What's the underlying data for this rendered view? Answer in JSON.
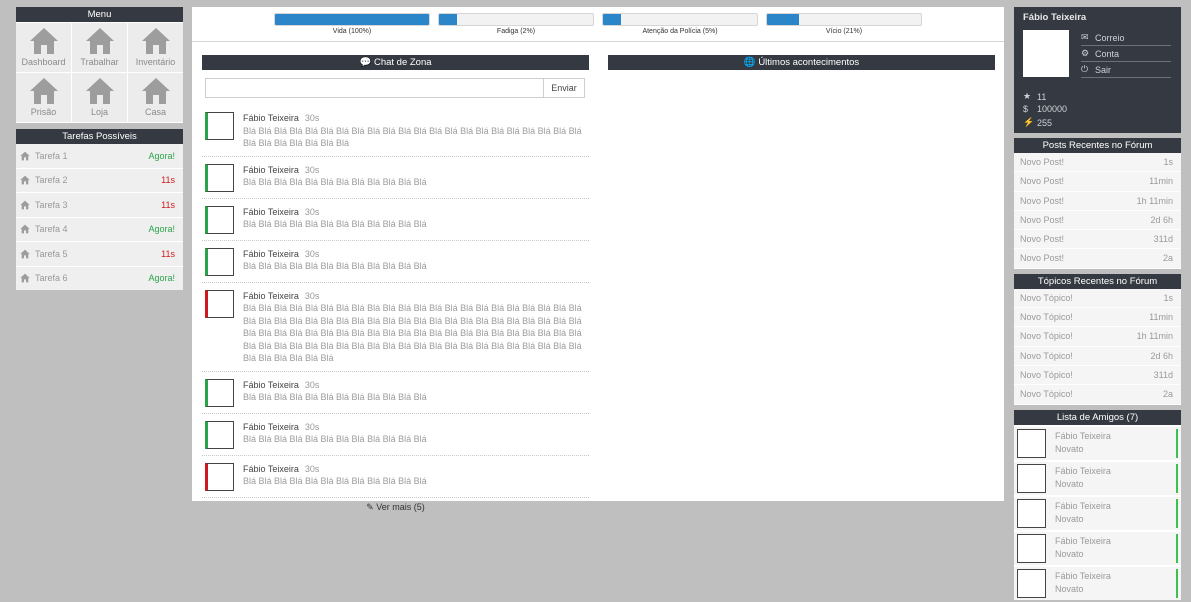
{
  "menu": {
    "title": "Menu",
    "items": [
      {
        "label": "Dashboard",
        "icon": "house-icon"
      },
      {
        "label": "Trabalhar",
        "icon": "house-icon"
      },
      {
        "label": "Inventário",
        "icon": "house-icon"
      },
      {
        "label": "Prisão",
        "icon": "house-icon"
      },
      {
        "label": "Loja",
        "icon": "house-icon"
      },
      {
        "label": "Casa",
        "icon": "house-icon"
      }
    ]
  },
  "tasks": {
    "title": "Tarefas Possíveis",
    "items": [
      {
        "name": "Tarefa 1",
        "time": "Agora!",
        "status": "green"
      },
      {
        "name": "Tarefa 2",
        "time": "11s",
        "status": "red"
      },
      {
        "name": "Tarefa 3",
        "time": "11s",
        "status": "red"
      },
      {
        "name": "Tarefa 4",
        "time": "Agora!",
        "status": "green"
      },
      {
        "name": "Tarefa 5",
        "time": "11s",
        "status": "red"
      },
      {
        "name": "Tarefa 6",
        "time": "Agora!",
        "status": "green"
      }
    ]
  },
  "bars": [
    {
      "label": "Vida (100%)",
      "value": 100
    },
    {
      "label": "Fadiga (2%)",
      "value": 2
    },
    {
      "label": "Atenção da Polícia (5%)",
      "value": 5
    },
    {
      "label": "Vício (21%)",
      "value": 21
    }
  ],
  "chat": {
    "title": "Chat de Zona",
    "input_placeholder": "",
    "send_label": "Enviar",
    "messages": [
      {
        "author": "Fábio Teixeira",
        "ago": "30s",
        "text": "Blá Blá Blá Blá Blá Blá Blá Blá Blá Blá Blá Blá Blá Blá Blá Blá Blá Blá Blá Blá Blá Blá Blá Blá Blá Blá Blá Blá Blá",
        "accent": "#2ba34a"
      },
      {
        "author": "Fábio Teixeira",
        "ago": "30s",
        "text": "Blá Blá Blá Blá Blá Blá Blá Blá Blá Blá Blá Blá",
        "accent": "#2ba34a"
      },
      {
        "author": "Fábio Teixeira",
        "ago": "30s",
        "text": "Blá Blá Blá Blá Blá Blá Blá Blá Blá Blá Blá Blá",
        "accent": "#2ba34a"
      },
      {
        "author": "Fábio Teixeira",
        "ago": "30s",
        "text": "Blá Blá Blá Blá Blá Blá Blá Blá Blá Blá Blá Blá",
        "accent": "#2ba34a"
      },
      {
        "author": "Fábio Teixeira",
        "ago": "30s",
        "text": "Blá Blá Blá Blá Blá Blá Blá Blá Blá Blá Blá Blá Blá Blá Blá Blá Blá Blá Blá Blá Blá Blá Blá Blá Blá Blá Blá Blá Blá Blá Blá Blá Blá Blá Blá Blá Blá Blá Blá Blá Blá Blá Blá Blá Blá Blá Blá Blá Blá Blá Blá Blá Blá Blá Blá Blá Blá Blá Blá Blá Blá Blá Blá Blá Blá Blá Blá Blá Blá Blá Blá Blá Blá Blá Blá Blá Blá Blá Blá Blá Blá Blá Blá Blá Blá Blá Blá Blá Blá Blá Blá Blá Blá Blá",
        "accent": "#d0181e"
      },
      {
        "author": "Fábio Teixeira",
        "ago": "30s",
        "text": "Blá Blá Blá Blá Blá Blá Blá Blá Blá Blá Blá Blá",
        "accent": "#2ba34a"
      },
      {
        "author": "Fábio Teixeira",
        "ago": "30s",
        "text": "Blá Blá Blá Blá Blá Blá Blá Blá Blá Blá Blá Blá",
        "accent": "#2ba34a"
      },
      {
        "author": "Fábio Teixeira",
        "ago": "30s",
        "text": "Blá Blá Blá Blá Blá Blá Blá Blá Blá Blá Blá Blá",
        "accent": "#d0181e"
      }
    ],
    "more_label": "Ver mais (5)"
  },
  "news": {
    "title": "Últimos acontecimentos"
  },
  "profile": {
    "name": "Fábio Teixeira",
    "links": [
      {
        "label": "Correio",
        "icon": "mail-icon"
      },
      {
        "label": "Conta",
        "icon": "gear-icon"
      },
      {
        "label": "Sair",
        "icon": "power-icon"
      }
    ],
    "stats": [
      {
        "value": "11",
        "icon": "star-icon"
      },
      {
        "value": "100000",
        "icon": "dollar-icon"
      },
      {
        "value": "255",
        "icon": "bolt-icon"
      }
    ]
  },
  "forum_posts": {
    "title": "Posts Recentes no Fórum",
    "items": [
      {
        "label": "Novo Post!",
        "time": "1s"
      },
      {
        "label": "Novo Post!",
        "time": "11min"
      },
      {
        "label": "Novo Post!",
        "time": "1h 11min"
      },
      {
        "label": "Novo Post!",
        "time": "2d 6h"
      },
      {
        "label": "Novo Post!",
        "time": "311d"
      },
      {
        "label": "Novo Post!",
        "time": "2a"
      }
    ]
  },
  "forum_topics": {
    "title": "Tópicos Recentes no Fórum",
    "items": [
      {
        "label": "Novo Tópico!",
        "time": "1s"
      },
      {
        "label": "Novo Tópico!",
        "time": "11min"
      },
      {
        "label": "Novo Tópico!",
        "time": "1h 11min"
      },
      {
        "label": "Novo Tópico!",
        "time": "2d 6h"
      },
      {
        "label": "Novo Tópico!",
        "time": "311d"
      },
      {
        "label": "Novo Tópico!",
        "time": "2a"
      }
    ]
  },
  "friends": {
    "title": "Lista de Amigos (7)",
    "items": [
      {
        "name": "Fábio Teixeira",
        "rank": "Novato"
      },
      {
        "name": "Fábio Teixeira",
        "rank": "Novato"
      },
      {
        "name": "Fábio Teixeira",
        "rank": "Novato"
      },
      {
        "name": "Fábio Teixeira",
        "rank": "Novato"
      },
      {
        "name": "Fábio Teixeira",
        "rank": "Novato"
      }
    ]
  },
  "colors": {
    "dark": "#353a42",
    "bar": "#2b86c9",
    "green": "#2ba34a",
    "red": "#d0181e"
  }
}
